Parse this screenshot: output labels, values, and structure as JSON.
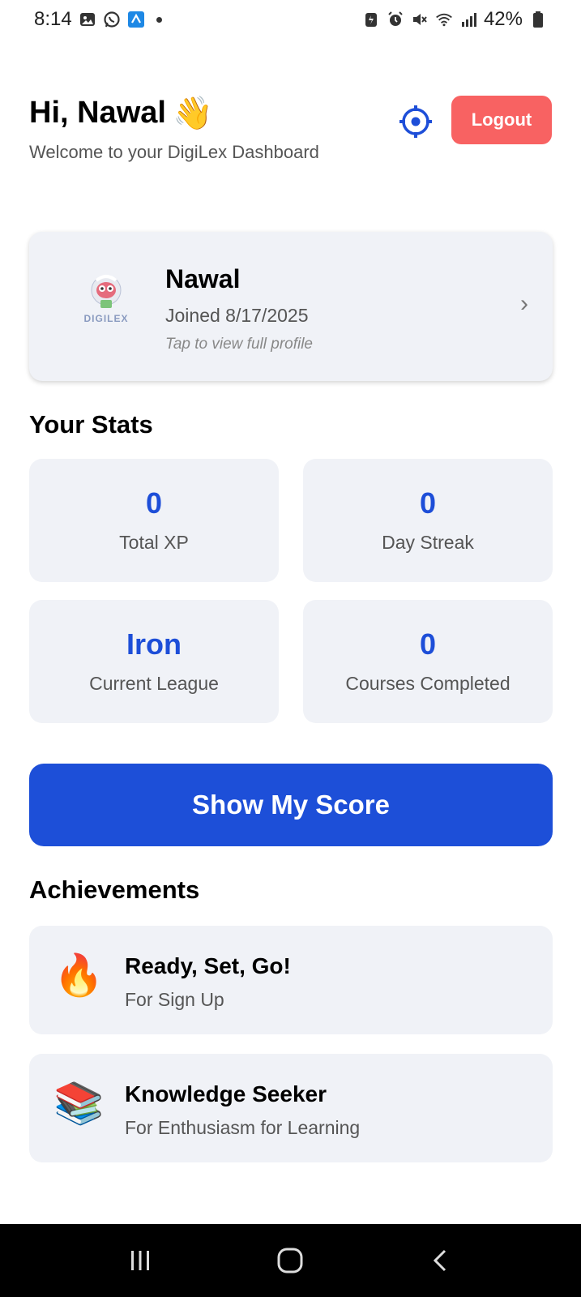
{
  "status_bar": {
    "time": "8:14",
    "battery": "42%",
    "icons": [
      "gallery-icon",
      "whatsapp-icon",
      "app-icon",
      "battery-saver-icon",
      "alarm-icon",
      "mute-icon",
      "wifi-icon",
      "signal-icon",
      "battery-icon"
    ]
  },
  "header": {
    "greeting": "Hi, Nawal",
    "wave_emoji": "👋",
    "subtitle": "Welcome to your DigiLex Dashboard",
    "logout_label": "Logout"
  },
  "profile": {
    "name": "Nawal",
    "joined": "Joined 8/17/2025",
    "tap_hint": "Tap to view full profile",
    "logo_text": "DIGILEX",
    "chevron": "›"
  },
  "stats": {
    "title": "Your Stats",
    "items": [
      {
        "value": "0",
        "label": "Total XP"
      },
      {
        "value": "0",
        "label": "Day Streak"
      },
      {
        "value": "Iron",
        "label": "Current League"
      },
      {
        "value": "0",
        "label": "Courses Completed"
      }
    ]
  },
  "score_button_label": "Show My Score",
  "achievements": {
    "title": "Achievements",
    "items": [
      {
        "icon": "🔥",
        "title": "Ready, Set, Go!",
        "desc": "For Sign Up"
      },
      {
        "icon": "📚",
        "title": "Knowledge Seeker",
        "desc": "For Enthusiasm for Learning"
      }
    ]
  },
  "colors": {
    "accent": "#1d4ed8",
    "logout": "#f86262",
    "card_bg": "#f0f2f7"
  }
}
